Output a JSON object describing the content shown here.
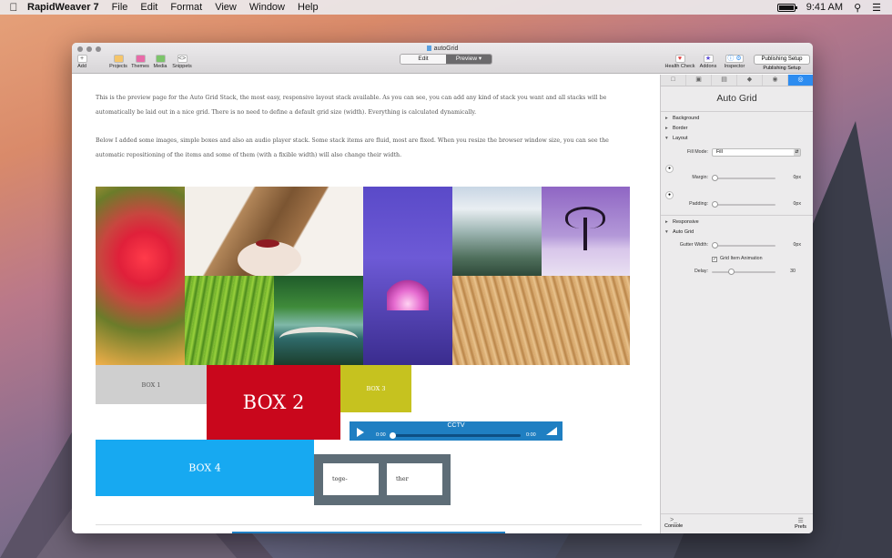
{
  "menubar": {
    "apple_icon": "apple-logo",
    "app_name": "RapidWeaver 7",
    "menus": [
      "File",
      "Edit",
      "Format",
      "View",
      "Window",
      "Help"
    ],
    "clock": "9:41 AM",
    "battery_icon": "battery-icon",
    "search_icon": "search-icon",
    "list_icon": "notification-list-icon"
  },
  "window": {
    "title": "autoGrid",
    "toolbar": {
      "add": "Add",
      "projects": "Projects",
      "themes": "Themes",
      "media": "Media",
      "snippets": "Snippets",
      "edit": "Edit",
      "preview": "Preview",
      "health_check": "Health Check",
      "addons": "Addons",
      "inspector": "Inspector",
      "publishing_setup_button": "Publishing Setup",
      "publishing_setup_label": "Publishing Setup"
    }
  },
  "page": {
    "paragraph1_line1": "This is the preview page for the Auto Grid Stack, the most easy, responsive layout stack available. As you can see, you can add any kind of stack you want and all stacks will be",
    "paragraph1_line2": "automatically be laid out in a nice grid. There is no need to define a default grid size (width). Everything is calculated dynamically.",
    "paragraph2_line1": "Below I added some images, simple boxes and also an audio player stack. Some stack items are fluid, most are fixed. When you resize the browser window size, you can see the",
    "paragraph2_line2": "automatic repositioning of the items and some of them (with a fixible width) will also change their width.",
    "boxes": {
      "box1": "BOX 1",
      "box2": "BOX 2",
      "box3": "BOX 3",
      "box4": "BOX 4"
    },
    "audio": {
      "title": "CCTV",
      "time_current": "0:00",
      "time_total": "0:00",
      "progress": 0
    },
    "together": {
      "left": "toge-",
      "right": "ther"
    }
  },
  "inspector": {
    "title": "Auto Grid",
    "sections": {
      "background": "Background",
      "border": "Border",
      "layout": "Layout",
      "responsive": "Responsive",
      "auto_grid": "Auto Grid"
    },
    "fill_mode_label": "Fill Mode:",
    "fill_mode_value": "Fill",
    "margin_label": "Margin:",
    "margin_value": "0px",
    "padding_label": "Padding:",
    "padding_value": "0px",
    "gutter_label": "Gutter Width:",
    "gutter_value": "0px",
    "grid_animation_label": "Grid Item Animation",
    "grid_animation_checked": true,
    "delay_label": "Delay:",
    "delay_value": "30",
    "console": "Console",
    "prefs": "Prefs"
  }
}
